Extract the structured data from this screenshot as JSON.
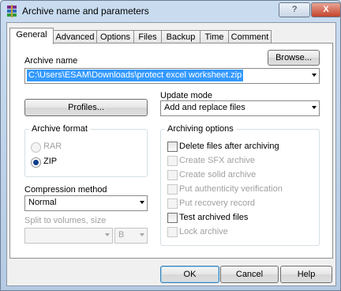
{
  "window": {
    "title": "Archive name and parameters",
    "help_label": "?",
    "close_label": "X"
  },
  "tabs": [
    {
      "label": "General",
      "active": true
    },
    {
      "label": "Advanced"
    },
    {
      "label": "Options"
    },
    {
      "label": "Files"
    },
    {
      "label": "Backup"
    },
    {
      "label": "Time"
    },
    {
      "label": "Comment"
    }
  ],
  "archive_name": {
    "label": "Archive name",
    "browse_label": "Browse...",
    "value": "C:\\Users\\ESAM\\Downloads\\protect excel worksheet.zip"
  },
  "profiles_label": "Profiles...",
  "update_mode": {
    "label": "Update mode",
    "value": "Add and replace files"
  },
  "archive_format": {
    "label": "Archive format",
    "options": [
      {
        "label": "RAR",
        "selected": false,
        "enabled": false
      },
      {
        "label": "ZIP",
        "selected": true,
        "enabled": true
      }
    ]
  },
  "compression": {
    "label": "Compression method",
    "value": "Normal"
  },
  "split": {
    "label": "Split to volumes, size",
    "value": "",
    "unit": "B"
  },
  "archiving_options": {
    "label": "Archiving options",
    "items": [
      {
        "label": "Delete files after archiving",
        "checked": false,
        "enabled": true
      },
      {
        "label": "Create SFX archive",
        "checked": false,
        "enabled": false
      },
      {
        "label": "Create solid archive",
        "checked": false,
        "enabled": false
      },
      {
        "label": "Put authenticity verification",
        "checked": false,
        "enabled": false
      },
      {
        "label": "Put recovery record",
        "checked": false,
        "enabled": false
      },
      {
        "label": "Test archived files",
        "checked": false,
        "enabled": true
      },
      {
        "label": "Lock archive",
        "checked": false,
        "enabled": false
      }
    ]
  },
  "footer": {
    "ok_label": "OK",
    "cancel_label": "Cancel",
    "help_label": "Help"
  }
}
